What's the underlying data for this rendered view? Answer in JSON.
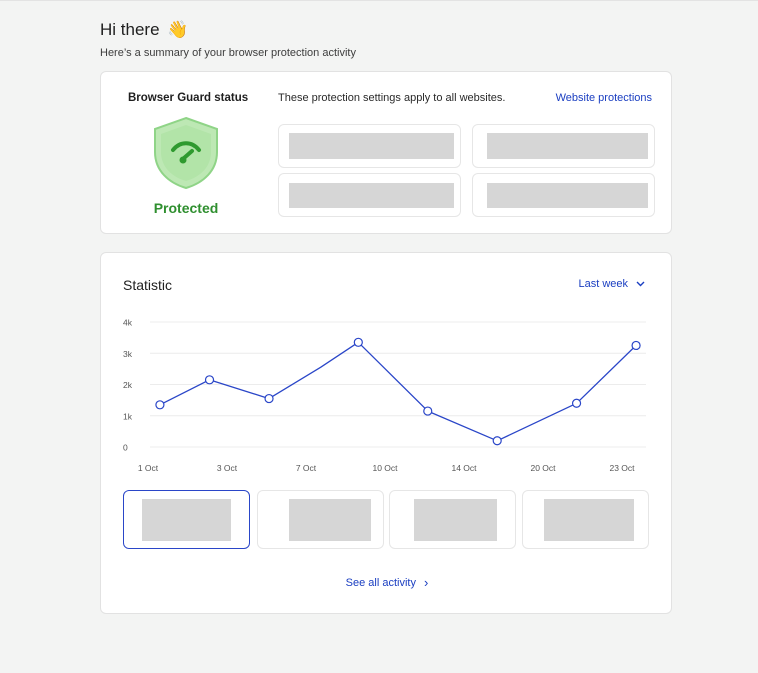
{
  "header": {
    "greeting": "Hi there",
    "wave_emoji": "👋",
    "subtitle": "Here’s a summary of your browser protection activity"
  },
  "status_card": {
    "title": "Browser Guard status",
    "state": "Protected",
    "description": "These protection settings apply to all websites.",
    "link": "Website protections",
    "icon": "shield-wifi-icon",
    "state_color": "#2f8f2f"
  },
  "stats_card": {
    "title": "Statistic",
    "period": "Last week",
    "see_all": "See all activity"
  },
  "colors": {
    "accent": "#1a3ec1",
    "line": "#2a46c8",
    "placeholder": "#d6d6d6"
  },
  "chart_data": {
    "type": "line",
    "y_ticks": [
      "0",
      "1k",
      "2k",
      "3k",
      "4k"
    ],
    "x_ticks": [
      "1 Oct",
      "3 Oct",
      "7 Oct",
      "10 Oct",
      "14 Oct",
      "20 Oct",
      "23 Oct"
    ],
    "ylim": [
      0,
      4000
    ],
    "grid": true,
    "series": [
      {
        "points": [
          {
            "x": 0.5,
            "y": 1350,
            "marker": true
          },
          {
            "x": 3.0,
            "y": 2150,
            "marker": true
          },
          {
            "x": 6.0,
            "y": 1550,
            "marker": true
          },
          {
            "x": 8.6,
            "y": 2550,
            "marker": false
          },
          {
            "x": 10.5,
            "y": 3350,
            "marker": true
          },
          {
            "x": 14.0,
            "y": 1150,
            "marker": true
          },
          {
            "x": 17.5,
            "y": 200,
            "marker": true
          },
          {
            "x": 21.5,
            "y": 1400,
            "marker": true
          },
          {
            "x": 24.5,
            "y": 3250,
            "marker": true
          }
        ]
      }
    ]
  }
}
